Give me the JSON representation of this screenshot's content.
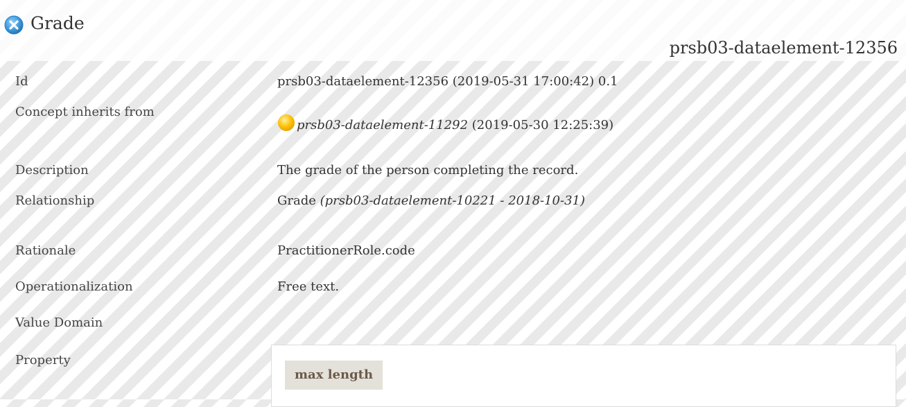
{
  "header": {
    "title": "Grade",
    "id": "prsb03-dataelement-12356",
    "icon": "close-icon",
    "icon_color": "#3d9ad9"
  },
  "rows": [
    {
      "label": "Id",
      "value": "prsb03-dataelement-12356 (2019-05-31 17:00:42) 0.1"
    },
    {
      "label": "Concept inherits from",
      "value_link": "prsb03-dataelement-11292",
      "value_rest": " (2019-05-30 12:25:39)",
      "icon": "status-dot-icon",
      "icon_color": "#ffc107"
    },
    {
      "label": "Description",
      "value": "The grade of the person completing the record."
    },
    {
      "label": "Relationship",
      "value_main": "Grade ",
      "value_ref": "(prsb03-dataelement-10221 - 2018-10-31)"
    },
    {
      "label": "Rationale",
      "value": "PractitionerRole.code"
    },
    {
      "label": "Operationalization",
      "value": "Free text."
    },
    {
      "label": "Value Domain",
      "value": ""
    },
    {
      "label": "Property",
      "value": ""
    }
  ],
  "property_table": {
    "header": "max length"
  }
}
